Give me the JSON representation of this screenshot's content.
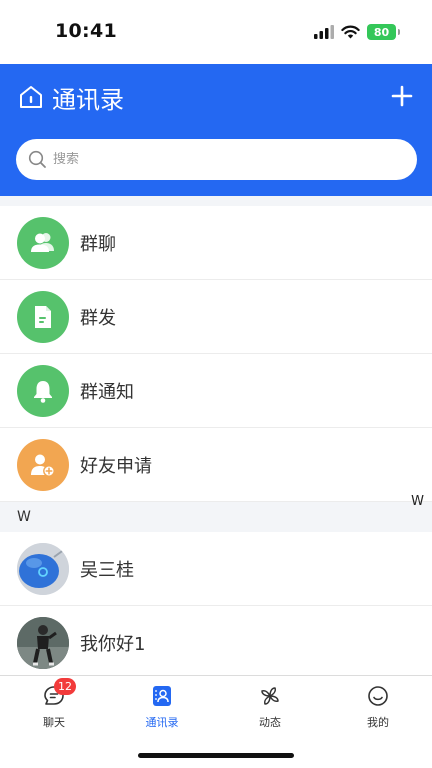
{
  "status_bar": {
    "time": "10:41",
    "battery": "80"
  },
  "header": {
    "title": "通讯录"
  },
  "search": {
    "placeholder": "搜索"
  },
  "menu_items": [
    {
      "label": "群聊",
      "icon": "group-chat-icon",
      "color": "#56c26c"
    },
    {
      "label": "群发",
      "icon": "document-icon",
      "color": "#56c26c"
    },
    {
      "label": "群通知",
      "icon": "bell-icon",
      "color": "#56c26c"
    },
    {
      "label": "好友申请",
      "icon": "add-friend-icon",
      "color": "#f2a651"
    }
  ],
  "sections": [
    {
      "letter": "W",
      "contacts": [
        {
          "name": "吴三桂",
          "avatar": "blue-mouse-avatar"
        },
        {
          "name": "我你好1",
          "avatar": "person-photo-avatar"
        }
      ]
    }
  ],
  "index_letters": [
    "W"
  ],
  "tabbar": {
    "tabs": [
      {
        "label": "聊天",
        "icon": "chat-icon",
        "badge": "12",
        "active": false
      },
      {
        "label": "通讯录",
        "icon": "contacts-icon",
        "active": true
      },
      {
        "label": "动态",
        "icon": "pinwheel-icon",
        "active": false
      },
      {
        "label": "我的",
        "icon": "smiley-icon",
        "active": false
      }
    ]
  },
  "colors": {
    "primary": "#2468f2",
    "green": "#56c26c",
    "orange": "#f2a651",
    "badge": "#f23b3b"
  }
}
